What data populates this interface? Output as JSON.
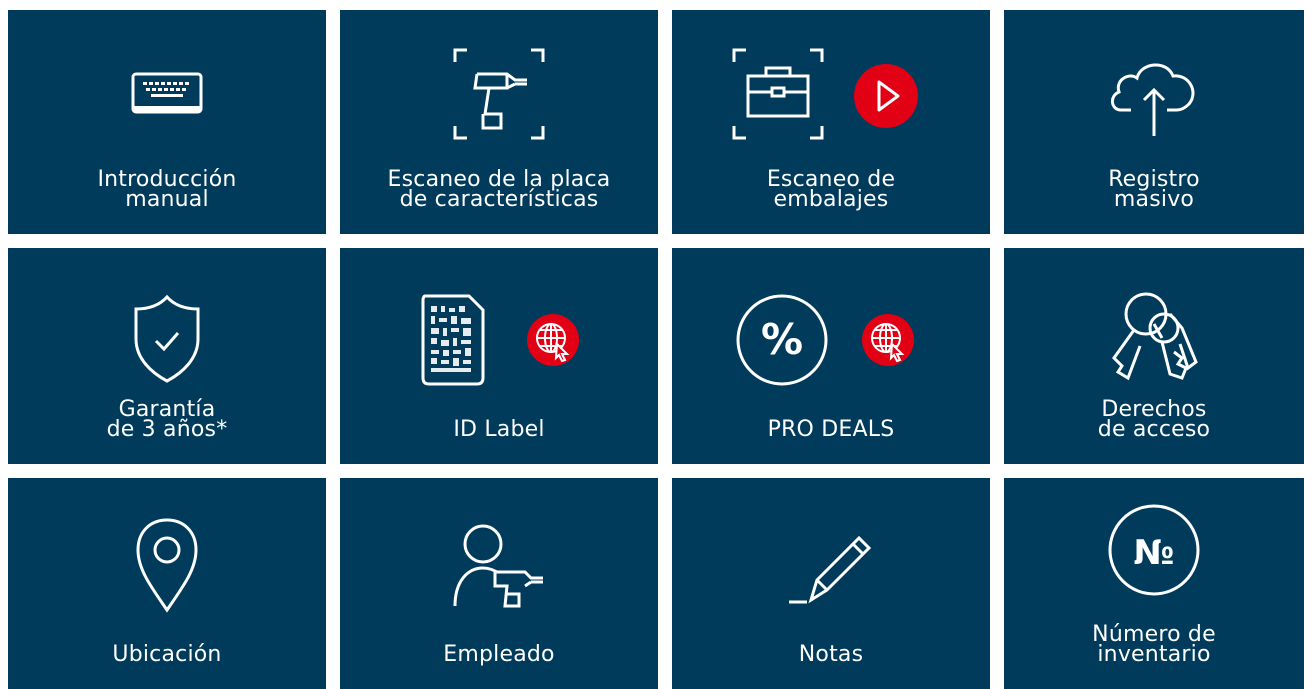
{
  "colors": {
    "tile_bg": "#003b5c",
    "accent_red": "#e20015",
    "text": "#ffffff"
  },
  "tiles": [
    {
      "id": "manual-entry",
      "icon": "keyboard-icon",
      "lines": [
        "Introducción",
        "manual"
      ]
    },
    {
      "id": "nameplate-scan",
      "icon": "drill-scan-icon",
      "lines": [
        "Escaneo de la placa",
        "de características"
      ]
    },
    {
      "id": "packaging-scan",
      "icon": "toolbox-scan-icon",
      "badge": "play-icon",
      "lines": [
        "Escaneo de",
        "embalajes"
      ]
    },
    {
      "id": "bulk-registration",
      "icon": "cloud-upload-icon",
      "lines": [
        "Registro",
        "masivo"
      ]
    },
    {
      "id": "warranty",
      "icon": "shield-check-icon",
      "lines": [
        "Garantía",
        "de 3 años*"
      ]
    },
    {
      "id": "id-label",
      "icon": "datamatrix-document-icon",
      "badge": "globe-cursor-icon",
      "lines": [
        "ID Label"
      ]
    },
    {
      "id": "pro-deals",
      "icon": "percent-icon",
      "badge": "globe-cursor-icon",
      "lines": [
        "PRO DEALS"
      ]
    },
    {
      "id": "access-rights",
      "icon": "keys-icon",
      "lines": [
        "Derechos",
        "de acceso"
      ]
    },
    {
      "id": "location",
      "icon": "location-pin-icon",
      "lines": [
        "Ubicación"
      ]
    },
    {
      "id": "employee",
      "icon": "person-drill-icon",
      "lines": [
        "Empleado"
      ]
    },
    {
      "id": "notes",
      "icon": "pencil-icon",
      "lines": [
        "Notas"
      ]
    },
    {
      "id": "inventory-number",
      "icon": "numero-sign-icon",
      "icon_text": "№",
      "lines": [
        "Número de",
        "inventario"
      ]
    }
  ]
}
